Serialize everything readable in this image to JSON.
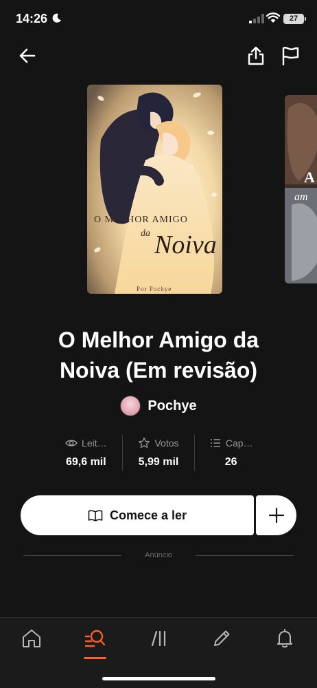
{
  "status_bar": {
    "time": "14:26",
    "battery": "27"
  },
  "nav": {
    "back_icon": "arrow-left-icon",
    "share_icon": "share-icon",
    "report_icon": "flag-icon"
  },
  "cover": {
    "title_line1": "O MELHOR AMIGO",
    "title_line2": "da",
    "title_line3": "Noiva",
    "credit": "Por Pochye",
    "next_cover_text1": "A",
    "next_cover_text2": "am"
  },
  "story": {
    "title": "O Melhor Amigo da Noiva (Em revisão)",
    "author": "Pochye"
  },
  "stats": [
    {
      "label": "Leit…",
      "value": "69,6 mil",
      "icon": "eye-icon"
    },
    {
      "label": "Votos",
      "value": "5,99 mil",
      "icon": "star-icon"
    },
    {
      "label": "Cap…",
      "value": "26",
      "icon": "list-icon"
    }
  ],
  "actions": {
    "read_label": "Comece a ler",
    "add_icon": "plus-icon"
  },
  "ad_label": "Anúncio",
  "bottom_nav": {
    "active_tab": "discover",
    "accent_color": "#ff6122",
    "tabs": [
      "home-icon",
      "search-icon",
      "library-icon",
      "pencil-icon",
      "bell-icon"
    ]
  }
}
